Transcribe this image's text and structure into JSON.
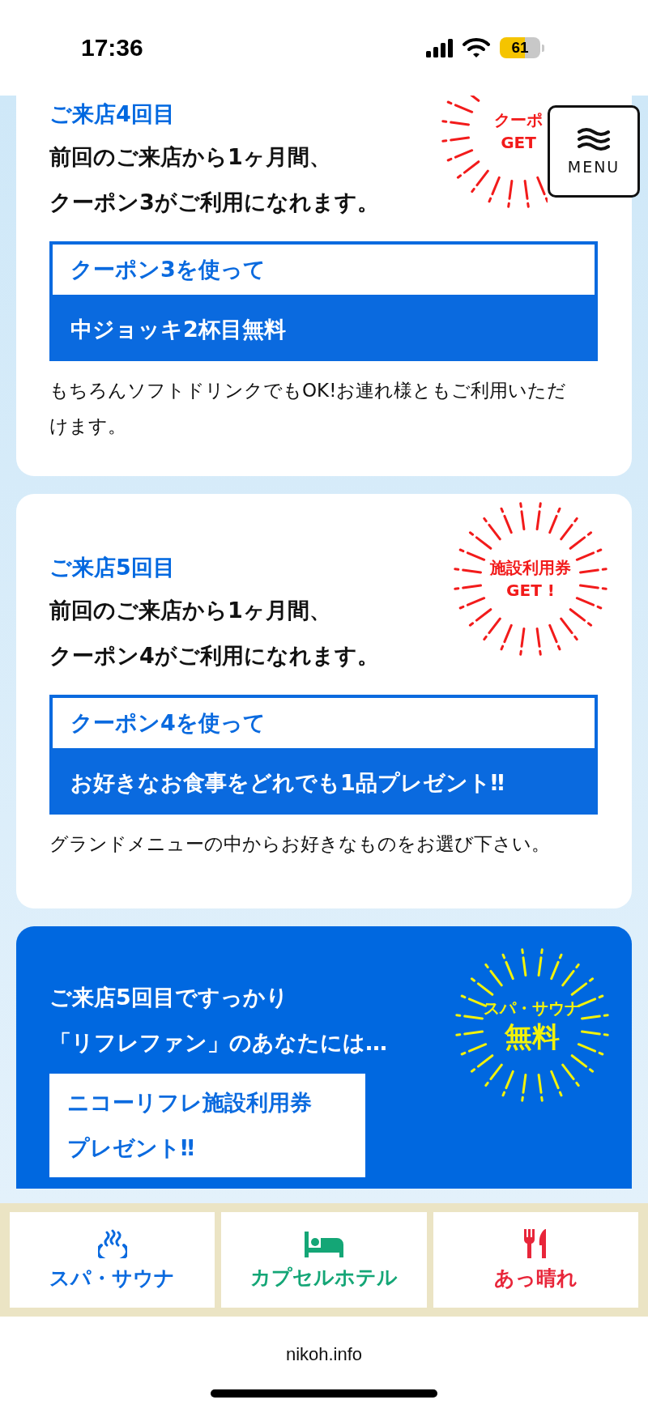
{
  "status_bar": {
    "time": "17:36",
    "battery": "61"
  },
  "menu_button": {
    "label": "MENU"
  },
  "cards": [
    {
      "kind": "visit",
      "visit": "ご来店4回目",
      "lines": [
        "前回のご来店から1ヶ月間、",
        "クーポン3がご利用になれます。"
      ],
      "badge": [
        "クーポ",
        "GET"
      ],
      "coupon": {
        "title": "クーポン3を使って",
        "offer": "中ジョッキ2杯目無料"
      },
      "note": "もちろんソフトドリンクでもOK!お連れ様ともご利用いただけます。"
    },
    {
      "kind": "visit",
      "visit": "ご来店5回目",
      "lines": [
        "前回のご来店から1ヶ月間、",
        "クーポン4がご利用になれます。"
      ],
      "badge": [
        "施設利用券",
        "GET !"
      ],
      "coupon": {
        "title": "クーポン4を使って",
        "offer": "お好きなお食事をどれでも1品プレゼント‼"
      },
      "note": "グランドメニューの中からお好きなものをお選び下さい。"
    },
    {
      "kind": "promo",
      "lines": [
        "ご来店5回目ですっかり",
        "「リフレファン」のあなたには…"
      ],
      "badge": [
        "スパ・サウナ",
        "無料"
      ],
      "offer_lines": [
        "ニコーリフレ施設利用券",
        "プレゼント‼"
      ]
    }
  ],
  "bottom_nav": [
    {
      "kind": "spa",
      "label": "スパ・サウナ",
      "color": "#0a6adf"
    },
    {
      "kind": "hotel",
      "label": "カプセルホテル",
      "color": "#14a676"
    },
    {
      "kind": "food",
      "label": "あっ晴れ",
      "color": "#e8263a"
    }
  ],
  "footer": {
    "url": "nikoh.info"
  }
}
